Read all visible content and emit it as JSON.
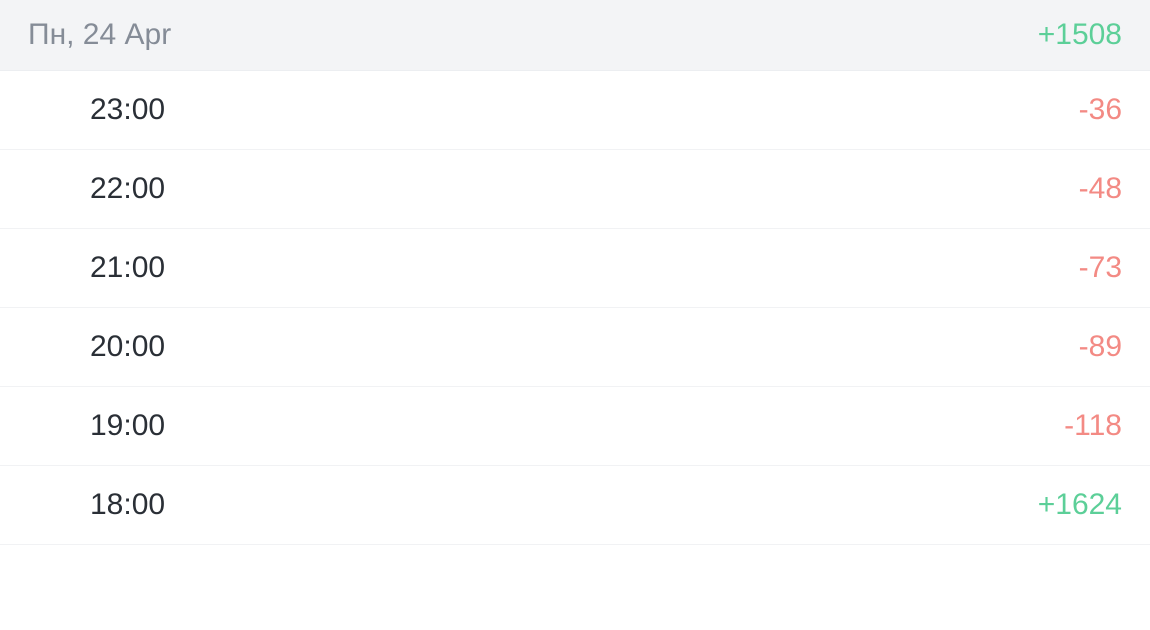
{
  "header": {
    "date": "Пн, 24 Apr",
    "total": "+1508",
    "totalSign": "positive"
  },
  "rows": [
    {
      "time": "23:00",
      "value": "-36",
      "sign": "negative"
    },
    {
      "time": "22:00",
      "value": "-48",
      "sign": "negative"
    },
    {
      "time": "21:00",
      "value": "-73",
      "sign": "negative"
    },
    {
      "time": "20:00",
      "value": "-89",
      "sign": "negative"
    },
    {
      "time": "19:00",
      "value": "-118",
      "sign": "negative"
    },
    {
      "time": "18:00",
      "value": "+1624",
      "sign": "positive"
    }
  ]
}
